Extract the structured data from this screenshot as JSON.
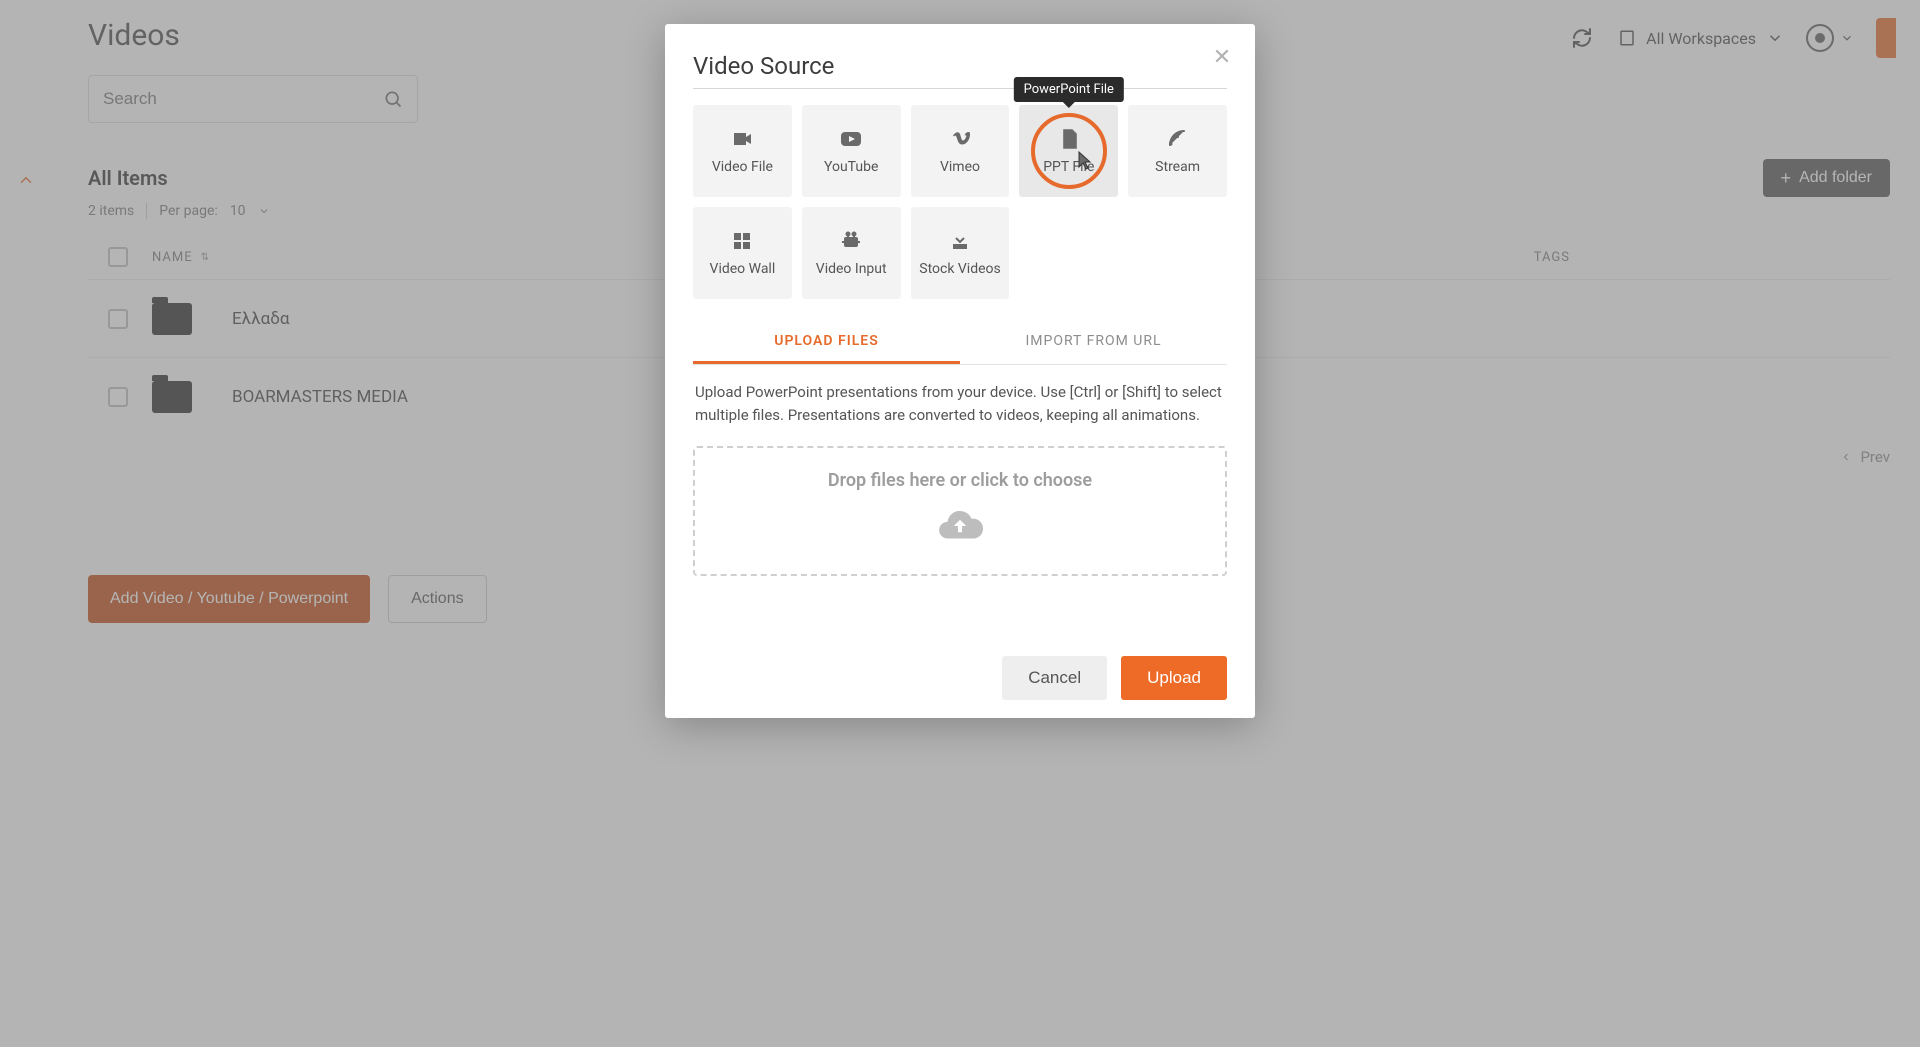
{
  "header": {
    "workspaces_label": "All Workspaces"
  },
  "page": {
    "title": "Videos",
    "search_placeholder": "Search",
    "section_title": "All Items",
    "add_folder_label": "Add folder",
    "items_count": "2 items",
    "per_page_label": "Per page:",
    "per_page_value": "10",
    "col_name": "NAME",
    "col_tags": "TAGS",
    "rows": [
      {
        "name": "Ελλαδα"
      },
      {
        "name": "BOARMASTERS MEDIA"
      }
    ],
    "btn_add_video": "Add Video / Youtube / Powerpoint",
    "btn_actions": "Actions",
    "prev_label": "Prev"
  },
  "modal": {
    "title": "Video Source",
    "tooltip": "PowerPoint File",
    "sources": [
      {
        "id": "video-file",
        "label": "Video File"
      },
      {
        "id": "youtube",
        "label": "YouTube"
      },
      {
        "id": "vimeo",
        "label": "Vimeo"
      },
      {
        "id": "ppt-file",
        "label": "PPT File",
        "selected": true
      },
      {
        "id": "stream",
        "label": "Stream"
      },
      {
        "id": "video-wall",
        "label": "Video Wall"
      },
      {
        "id": "video-input",
        "label": "Video Input"
      },
      {
        "id": "stock-videos",
        "label": "Stock Videos"
      }
    ],
    "tabs": {
      "upload": "UPLOAD FILES",
      "import": "IMPORT FROM URL"
    },
    "upload_description": "Upload PowerPoint presentations from your device. Use [Ctrl] or [Shift] to select multiple files. Presentations are converted to videos, keeping all animations.",
    "dropzone_label": "Drop files here or click to choose",
    "btn_cancel": "Cancel",
    "btn_upload": "Upload"
  }
}
